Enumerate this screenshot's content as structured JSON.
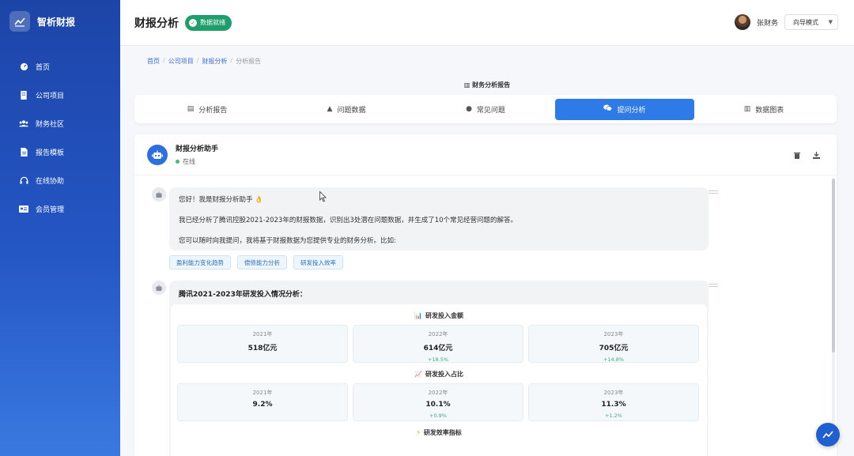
{
  "sidebar": {
    "brand": "智析财报",
    "items": [
      {
        "label": "首页",
        "icon": "dashboard-icon"
      },
      {
        "label": "公司项目",
        "icon": "building-icon"
      },
      {
        "label": "财务社区",
        "icon": "users-icon"
      },
      {
        "label": "报告模板",
        "icon": "document-icon"
      },
      {
        "label": "在线协助",
        "icon": "headset-icon"
      },
      {
        "label": "会员管理",
        "icon": "id-card-icon"
      }
    ]
  },
  "header": {
    "title": "财报分析",
    "status": "数据就绪",
    "user_name": "张财务",
    "mode": "向导模式"
  },
  "breadcrumb": [
    "首页",
    "公司项目",
    "财报分析",
    "分析报告"
  ],
  "report_caption": "财务分析报告",
  "tabs": [
    {
      "label": "分析报告",
      "icon": "file-icon"
    },
    {
      "label": "问题数据",
      "icon": "warning-icon"
    },
    {
      "label": "常见问题",
      "icon": "question-icon"
    },
    {
      "label": "提问分析",
      "icon": "chat-icon",
      "active": true
    },
    {
      "label": "数据图表",
      "icon": "chart-icon"
    }
  ],
  "chat": {
    "assistant_name": "财报分析助手",
    "online_status": "在线",
    "message1": {
      "line1": "您好！我是财报分析助手 👌",
      "line2": "我已经分析了腾讯控股2021-2023年的财报数据，识别出3处潜在问题数据，并生成了10个常见经营问题的解答。",
      "line3": "您可以随时向我提问，我将基于财报数据为您提供专业的财务分析。比如:"
    },
    "suggestions": [
      "盈利能力变化趋势",
      "偿债能力分析",
      "研发投入效率"
    ],
    "message2": {
      "title": "腾讯2021-2023年研发投入情况分析：",
      "amount_title": "研发投入金额",
      "amount": [
        {
          "year": "2021年",
          "value": "518亿元",
          "change": ""
        },
        {
          "year": "2022年",
          "value": "614亿元",
          "change": "+18.5%"
        },
        {
          "year": "2023年",
          "value": "705亿元",
          "change": "+14.8%"
        }
      ],
      "ratio_title": "研发投入占比",
      "ratio": [
        {
          "year": "2021年",
          "value": "9.2%",
          "change": ""
        },
        {
          "year": "2022年",
          "value": "10.1%",
          "change": "+0.9%"
        },
        {
          "year": "2023年",
          "value": "11.3%",
          "change": "+1.2%"
        }
      ],
      "efficiency_title": "研发效率指标"
    }
  },
  "colors": {
    "sidebar_top": "#1d45a8",
    "sidebar_bottom": "#3a79e0",
    "accent": "#2e7ae6",
    "status_green": "#1e9e6a",
    "change_green": "#3cae75"
  }
}
